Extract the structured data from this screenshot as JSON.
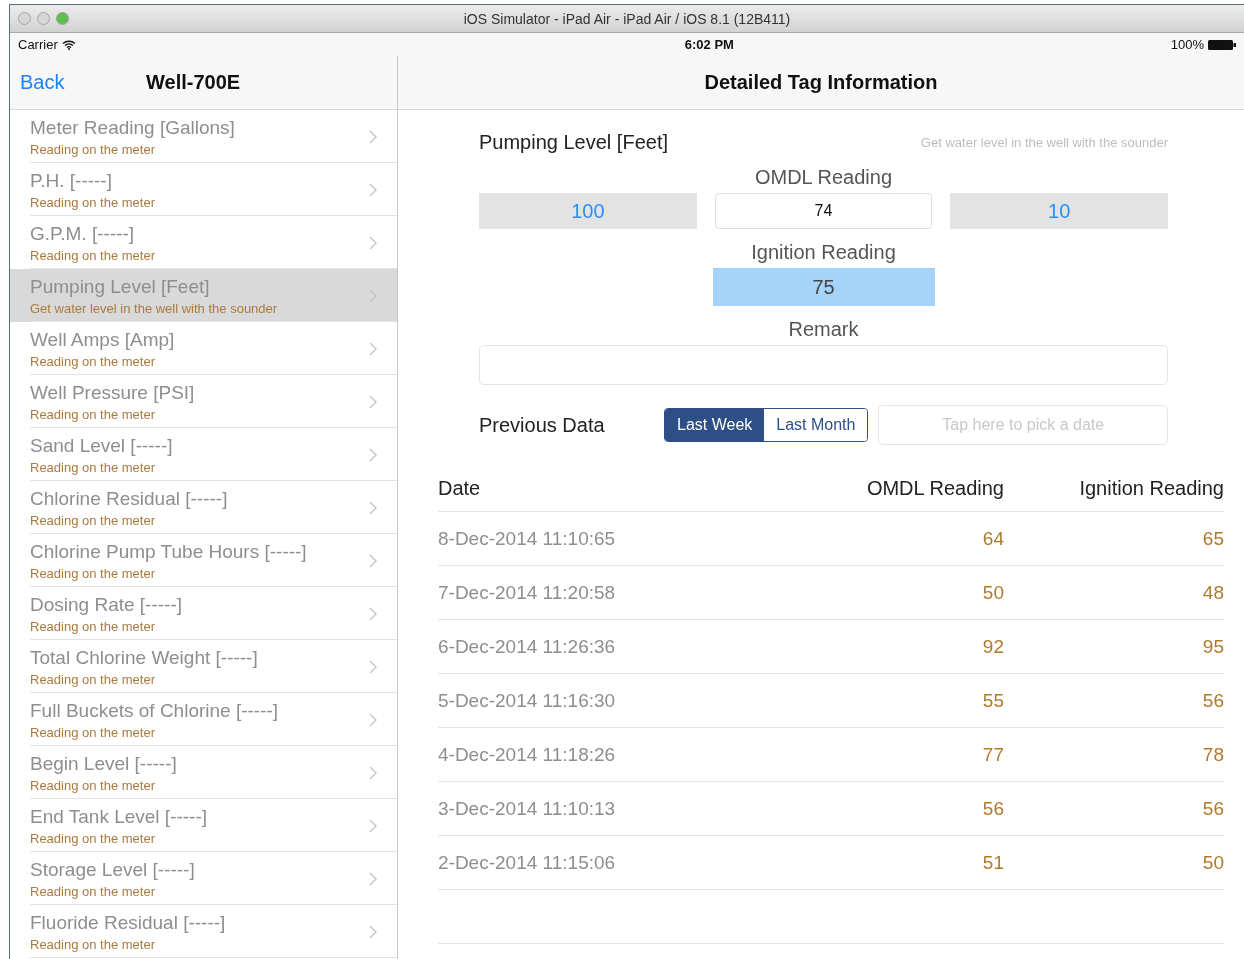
{
  "window": {
    "title": "iOS Simulator - iPad Air - iPad Air / iOS 8.1 (12B411)"
  },
  "status_bar": {
    "carrier": "Carrier",
    "time": "6:02 PM",
    "battery": "100%"
  },
  "sidebar": {
    "back": "Back",
    "title": "Well-700E",
    "items": [
      {
        "title": "Meter Reading [Gallons]",
        "subtitle": "Reading on the meter",
        "selected": false
      },
      {
        "title": "P.H. [-----]",
        "subtitle": "Reading on the meter",
        "selected": false
      },
      {
        "title": "G.P.M. [-----]",
        "subtitle": "Reading on the meter",
        "selected": false
      },
      {
        "title": "Pumping Level [Feet]",
        "subtitle": "Get water level in the well with the sounder",
        "selected": true
      },
      {
        "title": "Well Amps [Amp]",
        "subtitle": "Reading on the meter",
        "selected": false
      },
      {
        "title": "Well Pressure [PSI]",
        "subtitle": "Reading on the meter",
        "selected": false
      },
      {
        "title": "Sand Level [-----]",
        "subtitle": "Reading on the meter",
        "selected": false
      },
      {
        "title": "Chlorine Residual [-----]",
        "subtitle": "Reading on the meter",
        "selected": false
      },
      {
        "title": "Chlorine Pump Tube Hours [-----]",
        "subtitle": "Reading on the meter",
        "selected": false
      },
      {
        "title": "Dosing Rate [-----]",
        "subtitle": "Reading on the meter",
        "selected": false
      },
      {
        "title": "Total Chlorine Weight [-----]",
        "subtitle": "Reading on the meter",
        "selected": false
      },
      {
        "title": "Full Buckets of Chlorine [-----]",
        "subtitle": "Reading on the meter",
        "selected": false
      },
      {
        "title": "Begin Level [-----]",
        "subtitle": "Reading on the meter",
        "selected": false
      },
      {
        "title": "End Tank Level [-----]",
        "subtitle": "Reading on the meter",
        "selected": false
      },
      {
        "title": "Storage Level [-----]",
        "subtitle": "Reading on the meter",
        "selected": false
      },
      {
        "title": "Fluoride Residual [-----]",
        "subtitle": "Reading on the meter",
        "selected": false
      }
    ]
  },
  "detail": {
    "title": "Detailed Tag Information",
    "tag_name": "Pumping Level [Feet]",
    "tag_hint": "Get water level in the well with the sounder",
    "omdl_label": "OMDL Reading",
    "omdl_previous": "100",
    "omdl_value": "74",
    "omdl_next": "10",
    "ignition_label": "Ignition Reading",
    "ignition_value": "75",
    "remark_label": "Remark",
    "previous_label": "Previous Data",
    "periods": [
      {
        "label": "Last Week",
        "selected": true
      },
      {
        "label": "Last Month",
        "selected": false
      }
    ],
    "date_placeholder": "Tap here to pick a date",
    "table": {
      "columns": [
        "Date",
        "OMDL Reading",
        "Ignition Reading"
      ],
      "rows": [
        [
          "8-Dec-2014 11:10:65",
          "64",
          "65"
        ],
        [
          "7-Dec-2014 11:20:58",
          "50",
          "48"
        ],
        [
          "6-Dec-2014 11:26:36",
          "92",
          "95"
        ],
        [
          "5-Dec-2014 11:16:30",
          "55",
          "56"
        ],
        [
          "4-Dec-2014 11:18:26",
          "77",
          "78"
        ],
        [
          "3-Dec-2014 11:10:13",
          "56",
          "56"
        ],
        [
          "2-Dec-2014 11:15:06",
          "51",
          "50"
        ]
      ]
    }
  }
}
